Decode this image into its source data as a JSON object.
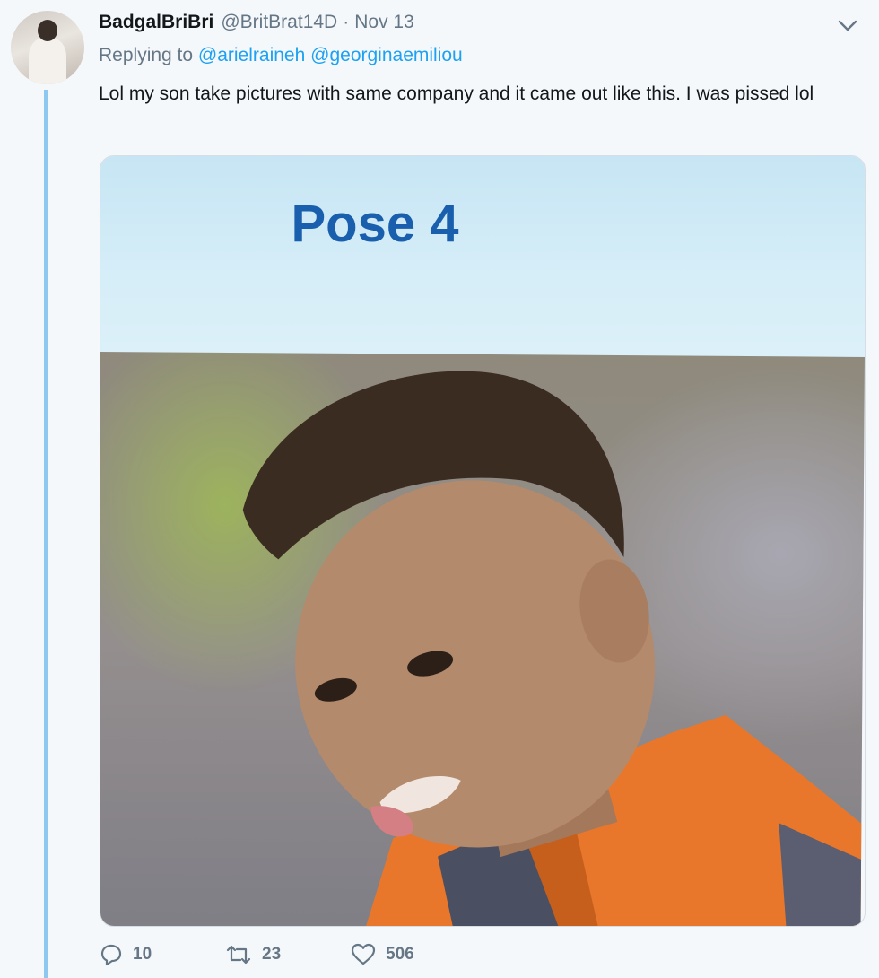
{
  "tweet": {
    "name": "BadgalBriBri",
    "handle": "@BritBrat14D",
    "separator": "·",
    "date": "Nov 13",
    "replying_prefix": "Replying to",
    "replying_to": [
      "@arielraineh",
      "@georginaemiliou"
    ],
    "text": "Lol my son take pictures with same company and it came out like this. I was pissed lol",
    "media": {
      "pose_label": "Pose 4"
    },
    "actions": {
      "replies": "10",
      "retweets": "23",
      "likes": "506"
    }
  },
  "icons": {
    "chevron": "chevron-down-icon",
    "reply": "reply-icon",
    "retweet": "retweet-icon",
    "like": "heart-icon"
  },
  "colors": {
    "link": "#1da1f2",
    "thread_line": "#8ec8f0",
    "muted": "#657786"
  }
}
